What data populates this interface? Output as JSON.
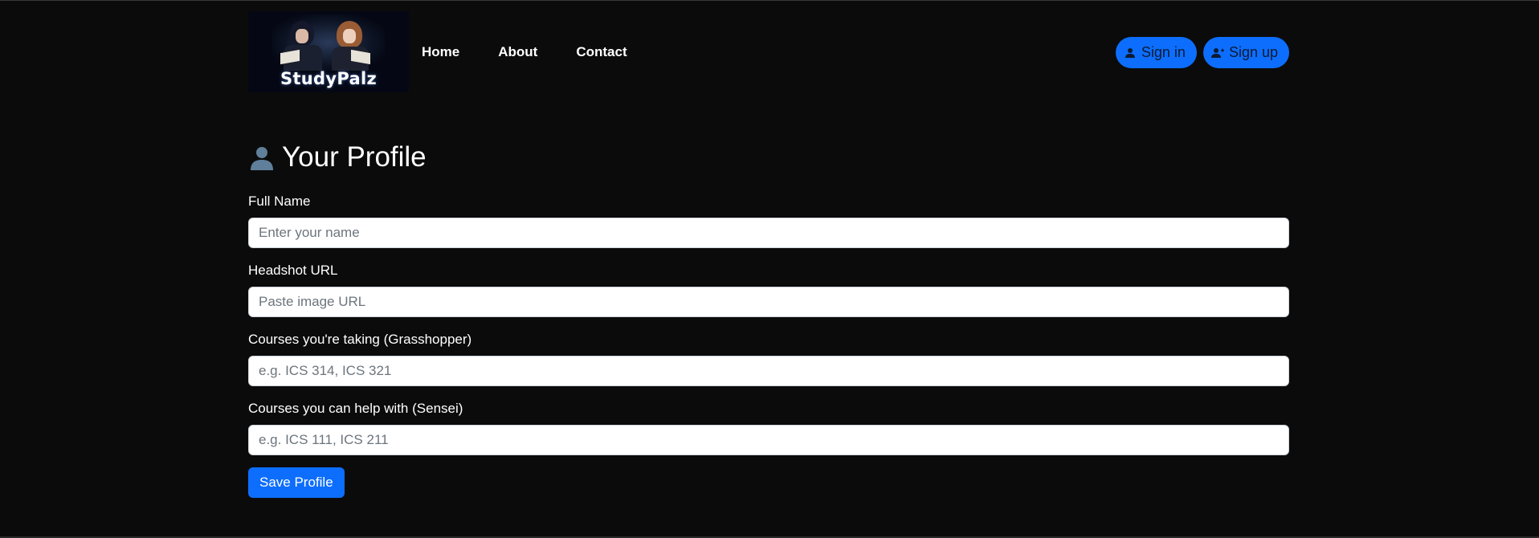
{
  "brand": {
    "logo_text": "StudyPalz"
  },
  "nav": {
    "links": [
      "Home",
      "About",
      "Contact"
    ],
    "sign_in": "Sign in",
    "sign_up": "Sign up",
    "accent": "#0d6efd"
  },
  "profile": {
    "title": "Your Profile",
    "title_icon": "bust-in-silhouette-icon",
    "fields": [
      {
        "label": "Full Name",
        "placeholder": "Enter your name",
        "value": ""
      },
      {
        "label": "Headshot URL",
        "placeholder": "Paste image URL",
        "value": ""
      },
      {
        "label": "Courses you're taking (Grasshopper)",
        "placeholder": "e.g. ICS 314, ICS 321",
        "value": ""
      },
      {
        "label": "Courses you can help with (Sensei)",
        "placeholder": "e.g. ICS 111, ICS 211",
        "value": ""
      }
    ],
    "save_label": "Save Profile"
  }
}
